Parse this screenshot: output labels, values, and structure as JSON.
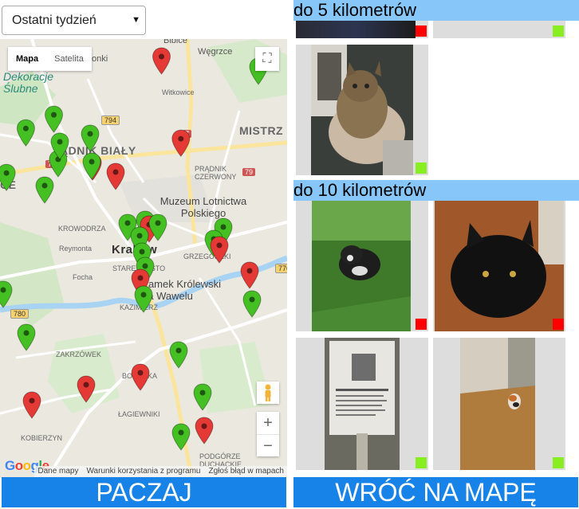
{
  "filter": {
    "selected": "Ostatni tydzień"
  },
  "map": {
    "maptype": {
      "map_label": "Mapa",
      "satellite_label": "Satelita"
    },
    "labels": {
      "bibice": "Bibice",
      "wegrzce": "Węgrzce",
      "zielonki": "ielonki",
      "dekoracje": "Dekoracje Ślubne",
      "wiktorowka": "Witkowice",
      "mistrz": "MISTRZ",
      "pradnik_bialy": "ĄDNIK BIAŁY",
      "pradnik_czerwony": "PRĄDNIK CZERWONY",
      "museum": "Muzeum Lotnictwa Polskiego",
      "krowodrza": "KROWODRZA",
      "reymonta": "Reymonta",
      "krakow": "Kraków",
      "stare_miasto": "STARE MIASTO",
      "zamek": "Zamek Królewski na Wawelu",
      "kazimierz": "KAZIMIERZ",
      "focha": "Focha",
      "grzegorzki": "GRZEGÓRZKI",
      "zakrzowek": "ZAKRZÓWEK",
      "borek": "BONARKA",
      "lagiewniki": "ŁAGIEWNIKI",
      "kobierzyn": "KOBIERZYN",
      "podgorze": "PODGÓRZE DUCHACKIE",
      "ce": "CE",
      "road_794": "794",
      "road_7a": "7",
      "road_7b": "7",
      "road_79": "79",
      "road_776": "776",
      "road_780": "780"
    },
    "footer": {
      "logo": "Google",
      "data": "Dane mapy",
      "terms": "Warunki korzystania z programu",
      "report": "Zgłoś błąd w mapach"
    },
    "pins": [
      {
        "color": "#e53935",
        "lat": 50.105,
        "lng": 19.945
      },
      {
        "color": "#44c023",
        "lat": 50.102,
        "lng": 19.99
      },
      {
        "color": "#44c023",
        "lat": 50.088,
        "lng": 19.895
      },
      {
        "color": "#44c023",
        "lat": 50.084,
        "lng": 19.882
      },
      {
        "color": "#e53935",
        "lat": 50.081,
        "lng": 19.954
      },
      {
        "color": "#44c023",
        "lat": 50.075,
        "lng": 19.897
      },
      {
        "color": "#e53935",
        "lat": 50.074,
        "lng": 19.913
      },
      {
        "color": "#44c023",
        "lat": 50.071,
        "lng": 19.873
      }
    ]
  },
  "buttons": {
    "paczaj": "PACZAJ",
    "wroc": "WRÓĆ NA MAPĘ"
  },
  "sections": [
    {
      "title": "do 5 kilometrów"
    },
    {
      "title": "do 10 kilometrów"
    }
  ],
  "cards": [
    {
      "status": "red"
    },
    {
      "status": "green"
    },
    {
      "status": "green"
    },
    {
      "status": "red"
    },
    {
      "status": "red"
    },
    {
      "status": "green"
    },
    {
      "status": "green"
    }
  ],
  "colors": {
    "accent": "#1783e8",
    "header": "#86c6f9",
    "pin_red": "#e53935",
    "pin_green": "#44c023"
  }
}
